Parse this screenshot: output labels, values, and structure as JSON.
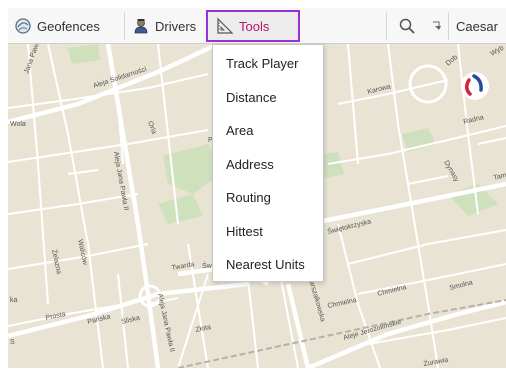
{
  "toolbar": {
    "geofences_label": "Geofences",
    "drivers_label": "Drivers",
    "tools_label": "Tools",
    "user_label": "Caesar"
  },
  "tools_menu": {
    "items": [
      "Track Player",
      "Distance",
      "Area",
      "Address",
      "Routing",
      "Hittest",
      "Nearest Units"
    ]
  },
  "map": {
    "labels": {
      "wola": "Wola",
      "aleja_solidarnosci": "Aleja Solidarności",
      "jana_pawla_top": "Jana Pawła II",
      "orla": "Orla",
      "aleja_jana_pawla": "Aleja Jana Pawła II",
      "walicow": "Waliców",
      "zelazna": "Żelazna",
      "twarda": "Twarda",
      "prosta": "Prosta",
      "panska": "Pańska",
      "sliska": "Sliska",
      "zlota": "Złota",
      "aleja_jana_pawla_bottom": "Aleja Jana Pawła II",
      "marszalkowska": "Marszałkowska",
      "swietokrzyska": "Świętokrzyska",
      "chmielna_1": "Chmielna",
      "chmielna_2": "Chmielna",
      "smolna": "Smolna",
      "aleje_jerozolimskie": "Aleje Jerozolimskie",
      "zurawia": "Żurawia",
      "karowa": "Karowa",
      "radna": "Radna",
      "dynasy": "Dynasy",
      "tamka": "Tam",
      "wybrzeze": "Wyb",
      "dobra": "Dob",
      "ptr": "Pt",
      "sw": "Św",
      "ka": "ka",
      "sto": "S"
    },
    "colors": {
      "land": "#e8e3d3",
      "road": "#ffffff",
      "park": "#cfe0bd",
      "rail": "#b8b0a8"
    }
  },
  "accent": "#9b30d9"
}
